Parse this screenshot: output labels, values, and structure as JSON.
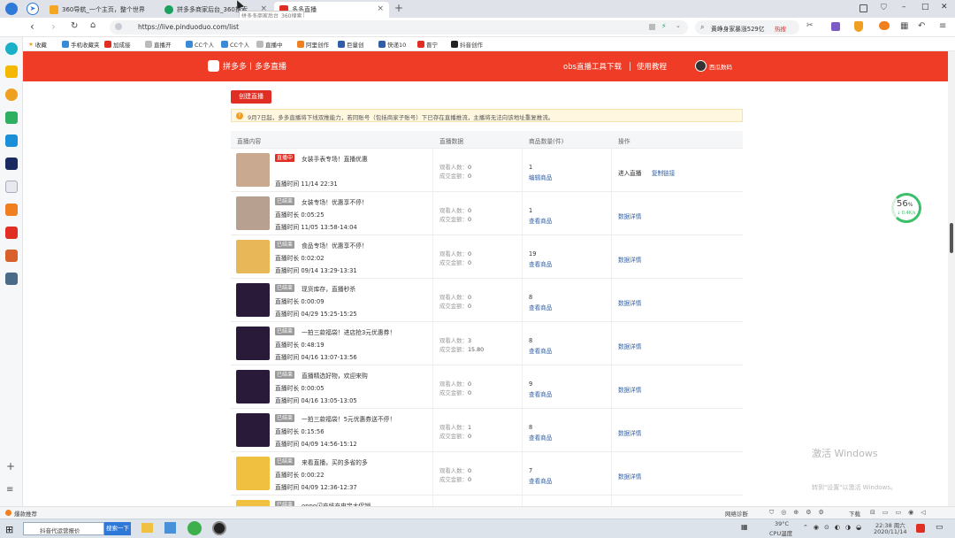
{
  "browser": {
    "tabs": [
      {
        "label": "360导航_一个主页，整个世界"
      },
      {
        "label": "拼多多商家后台_360搜索"
      },
      {
        "label": "多多直播"
      }
    ],
    "tab_tooltip": "拼多多商家后台_360搜索",
    "address": "https://live.pinduoduo.com/list",
    "search_box": "黄峥身家暴涨529亿",
    "search_tag": "热搜",
    "new_tab_symbol": "+",
    "window_buttons": [
      "–",
      "□",
      "✕"
    ]
  },
  "bookmarks": [
    "收藏",
    "手机收藏夹",
    "加成接",
    "直播开",
    "CC个人",
    "CC个人",
    "直播中",
    "阿里创作",
    "巨量创",
    "快递10",
    "晋宁",
    "抖音创作"
  ],
  "header": {
    "logo_text": "拼多多丨多多直播",
    "nav_obs": "obs直播工具下载",
    "nav_tutorial": "使用教程",
    "user_name": "西瓜数码"
  },
  "create_button": "创建直播",
  "notice": "9月7日起，多多直播将下线双推能力，若同账号（包括商家子账号）下已存在直播推流，主播将无法向该地址重复推流。",
  "columns": [
    "直播内容",
    "直播数据",
    "商品数量(件)",
    "操作"
  ],
  "rows": [
    {
      "status": "直播中",
      "status_color": "#e02e24",
      "title": "女装手表专场！直播优惠",
      "duration": "",
      "time": "直播时间 11/14 22:31",
      "viewers_label": "观看人数：",
      "viewers": "0",
      "orders_label": "成交金额：",
      "orders": "0",
      "qty": "1",
      "qty_link": "编辑商品",
      "op1": "进入直播",
      "op2": "复制链接",
      "thumb": "#c9a98f"
    },
    {
      "status": "已结束",
      "status_color": "#9a9a9a",
      "title": "女装专场！优惠享不停！",
      "duration": "直播时长 0:05:25",
      "time": "直播时间 11/05 13:58-14:04",
      "viewers_label": "观看人数：",
      "viewers": "0",
      "orders_label": "成交金额：",
      "orders": "0",
      "qty": "1",
      "qty_link": "查看商品",
      "op1": "数据详情",
      "op2": "",
      "thumb": "#b8a090"
    },
    {
      "status": "已结束",
      "status_color": "#9a9a9a",
      "title": "食品专场！优惠享不停！",
      "duration": "直播时长 0:02:02",
      "time": "直播时间 09/14 13:29-13:31",
      "viewers_label": "观看人数：",
      "viewers": "0",
      "orders_label": "成交金额：",
      "orders": "0",
      "qty": "19",
      "qty_link": "查看商品",
      "op1": "数据详情",
      "op2": "",
      "thumb": "#e8b758"
    },
    {
      "status": "已结束",
      "status_color": "#9a9a9a",
      "title": "现货库存，直播秒杀",
      "duration": "直播时长 0:00:09",
      "time": "直播时间 04/29 15:25-15:25",
      "viewers_label": "观看人数：",
      "viewers": "0",
      "orders_label": "成交金额：",
      "orders": "0",
      "qty": "8",
      "qty_link": "查看商品",
      "op1": "数据详情",
      "op2": "",
      "thumb": "#2a1a3a"
    },
    {
      "status": "已结束",
      "status_color": "#9a9a9a",
      "title": "一拍三款福袋！进店抢3元优惠券！",
      "duration": "直播时长 0:48:19",
      "time": "直播时间 04/16 13:07-13:56",
      "viewers_label": "观看人数：",
      "viewers": "3",
      "orders_label": "成交金额：",
      "orders": "15.80",
      "qty": "8",
      "qty_link": "查看商品",
      "op1": "数据详情",
      "op2": "",
      "thumb": "#2a1a3a"
    },
    {
      "status": "已结束",
      "status_color": "#9a9a9a",
      "title": "直播精选好物，欢迎来购",
      "duration": "直播时长 0:00:05",
      "time": "直播时间 04/16 13:05-13:05",
      "viewers_label": "观看人数：",
      "viewers": "0",
      "orders_label": "成交金额：",
      "orders": "0",
      "qty": "9",
      "qty_link": "查看商品",
      "op1": "数据详情",
      "op2": "",
      "thumb": "#2a1a3a"
    },
    {
      "status": "已结束",
      "status_color": "#9a9a9a",
      "title": "一拍三款福袋！5元优惠券送不停！",
      "duration": "直播时长 0:15:56",
      "time": "直播时间 04/09 14:56-15:12",
      "viewers_label": "观看人数：",
      "viewers": "1",
      "orders_label": "成交金额：",
      "orders": "0",
      "qty": "8",
      "qty_link": "查看商品",
      "op1": "数据详情",
      "op2": "",
      "thumb": "#2a1a3a"
    },
    {
      "status": "已结束",
      "status_color": "#9a9a9a",
      "title": "来看直播，买的多省的多",
      "duration": "直播时长 0:00:22",
      "time": "直播时间 04/09 12:36-12:37",
      "viewers_label": "观看人数：",
      "viewers": "0",
      "orders_label": "成交金额：",
      "orders": "0",
      "qty": "7",
      "qty_link": "查看商品",
      "op1": "数据详情",
      "op2": "",
      "thumb": "#f0c040"
    },
    {
      "status": "已结束",
      "status_color": "#9a9a9a",
      "title": "oppo闪充线充电宝大促销",
      "duration": "",
      "time": "",
      "viewers_label": "",
      "viewers": "",
      "orders_label": "",
      "orders": "",
      "qty": "",
      "qty_link": "",
      "op1": "",
      "op2": "",
      "thumb": "#f0c040"
    }
  ],
  "speed_widget": {
    "percent": "56",
    "unit": "%",
    "rate": "0.4K/s"
  },
  "watermark": {
    "line1": "激活 Windows",
    "line2": "转到\"设置\"以激活 Windows。"
  },
  "statusbar": {
    "left": "爆款推荐",
    "right_net": "网络诊断",
    "right_dl": "下载"
  },
  "taskbar": {
    "search_value": "抖音代运营报价",
    "search_button": "搜索一下",
    "weather": "39°C",
    "cpu": "CPU温度",
    "time": "22:38 周六",
    "date": "2020/11/14"
  }
}
